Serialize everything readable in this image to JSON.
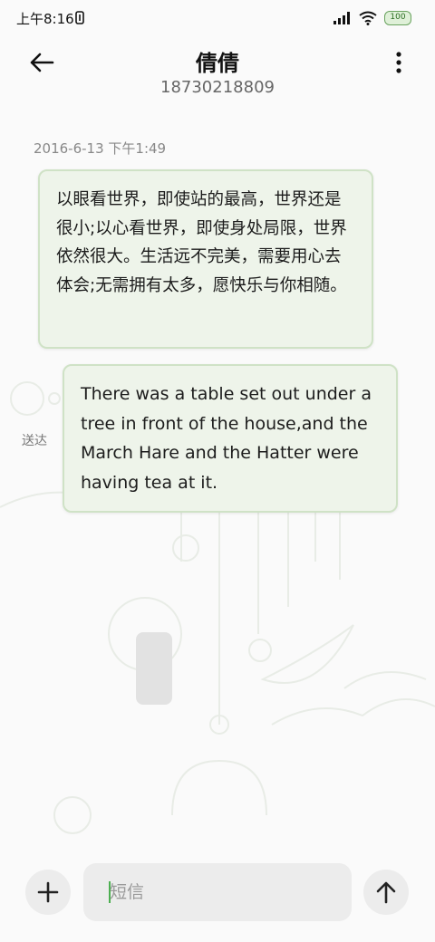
{
  "status_bar": {
    "time": "上午8:16",
    "battery": "100"
  },
  "header": {
    "contact_name": "倩倩",
    "contact_number": "18730218809"
  },
  "conversation": {
    "timestamp": "2016-6-13 下午1:49",
    "messages": [
      {
        "text": "以眼看世界，即使站的最高，世界还是很小;以心看世界，即使身处局限，世界依然很大。生活远不完美，需要用心去体会;无需拥有太多，愿快乐与你相随。"
      },
      {
        "text": "There was a table set out under a tree in front of the house,and the March Hare and the Hatter were having tea at it.",
        "status": "送达"
      }
    ]
  },
  "composer": {
    "placeholder": "短信"
  },
  "colors": {
    "bubble_bg": "#eef4ea",
    "bubble_border": "#cfe2c6",
    "accent": "#4caf50"
  }
}
